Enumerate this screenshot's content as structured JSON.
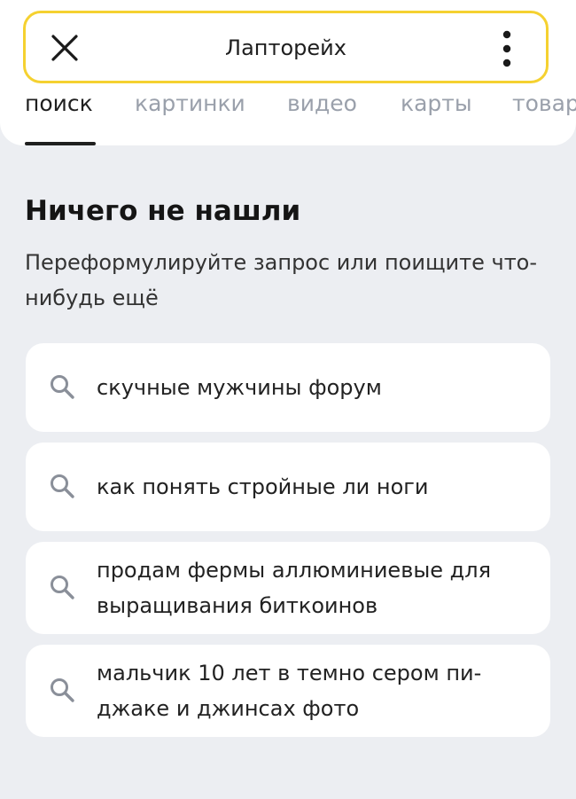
{
  "header": {
    "query": "Лапторейх"
  },
  "tabs": [
    {
      "label": "поиск",
      "active": true
    },
    {
      "label": "картинки",
      "active": false
    },
    {
      "label": "видео",
      "active": false
    },
    {
      "label": "карты",
      "active": false
    },
    {
      "label": "товар",
      "active": false
    }
  ],
  "empty_state": {
    "title": "Ничего не нашли",
    "subtitle": "Переформулируйте запрос или поищите что-нибудь ещё"
  },
  "suggestions": [
    {
      "text": "скучные мужчины форум",
      "icon": "search-icon"
    },
    {
      "text": "как понять стройные ли ноги",
      "icon": "search-icon"
    },
    {
      "text": "продам фермы аллюминиевые для выращивания биткоинов",
      "icon": "search-icon"
    },
    {
      "text": "мальчик 10 лет в темно сером пи­джаке и джинсах фото",
      "icon": "search-icon"
    }
  ],
  "colors": {
    "accent_border": "#f5d130",
    "background": "#eceef2",
    "card": "#ffffff",
    "inactive_tab": "#9aa0ab"
  }
}
